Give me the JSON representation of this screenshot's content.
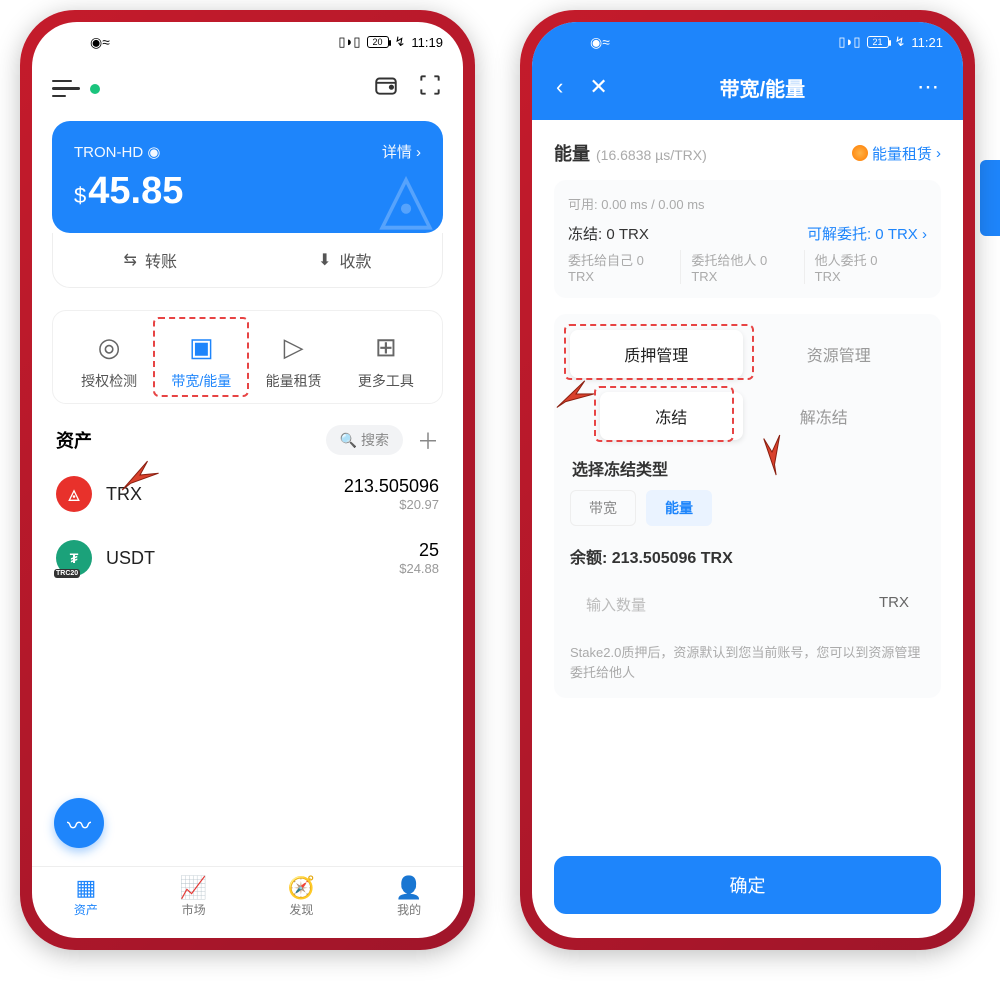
{
  "status": {
    "left": {
      "time": "11:19",
      "battery": "20"
    },
    "right": {
      "time": "11:21",
      "battery": "21"
    }
  },
  "left": {
    "wallet_name": "TRON-HD",
    "details": "详情",
    "balance": "45.85",
    "currency": "$",
    "actions": {
      "transfer": "转账",
      "receive": "收款"
    },
    "tools": [
      "授权检测",
      "带宽/能量",
      "能量租赁",
      "更多工具"
    ],
    "assets_title": "资产",
    "search": "搜索",
    "assets": [
      {
        "symbol": "TRX",
        "amount": "213.505096",
        "usd": "$20.97",
        "color": "#e8312b"
      },
      {
        "symbol": "USDT",
        "amount": "25",
        "usd": "$24.88",
        "color": "#1ba27a",
        "badge": "TRC20"
      }
    ],
    "nav": [
      "资产",
      "市场",
      "发现",
      "我的"
    ]
  },
  "right": {
    "header_title": "带宽/能量",
    "energy_label": "能量",
    "energy_rate": "(16.6838 µs/TRX)",
    "rent_link": "能量租赁",
    "available": "可用: 0.00 ms / 0.00 ms",
    "freeze": {
      "label": "冻结: 0 TRX",
      "delegate_label": "可解委托: 0 TRX"
    },
    "cols": [
      {
        "t": "委托给自己 0",
        "s": "TRX"
      },
      {
        "t": "委托给他人 0",
        "s": "TRX"
      },
      {
        "t": "他人委托 0",
        "s": "TRX"
      }
    ],
    "seg1": [
      "质押管理",
      "资源管理"
    ],
    "seg2": [
      "冻结",
      "解冻结"
    ],
    "freeze_type_title": "选择冻结类型",
    "freeze_types": [
      "带宽",
      "能量"
    ],
    "balance_label": "余额: 213.505096 TRX",
    "input_placeholder": "输入数量",
    "input_unit": "TRX",
    "note": "Stake2.0质押后，资源默认到您当前账号，您可以到资源管理委托给他人",
    "confirm": "确定"
  }
}
